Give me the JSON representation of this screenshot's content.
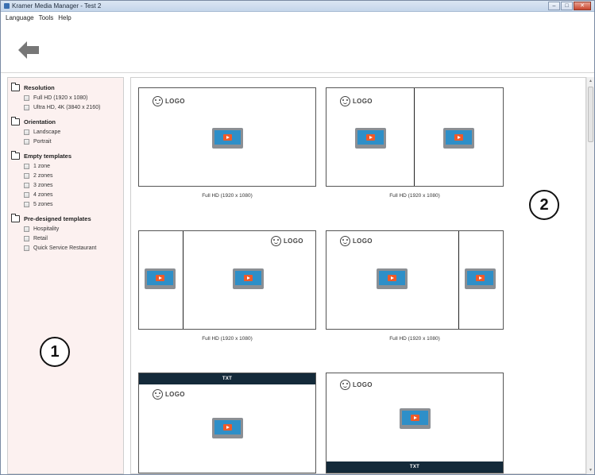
{
  "window": {
    "title": "Kramer Media Manager - Test 2",
    "controls": [
      "minimize",
      "maximize",
      "close"
    ]
  },
  "menu": [
    "Language",
    "Tools",
    "Help"
  ],
  "toolbar": {
    "back_icon": "back-arrow-icon"
  },
  "sidebar": {
    "groups": [
      {
        "label": "Resolution",
        "options": [
          "Full HD (1920 x 1080)",
          "Ultra HD, 4K (3840 x 2160)"
        ]
      },
      {
        "label": "Orientation",
        "options": [
          "Landscape",
          "Portrait"
        ]
      },
      {
        "label": "Empty templates",
        "options": [
          "1 zone",
          "2 zones",
          "3 zones",
          "4 zones",
          "5 zones"
        ]
      },
      {
        "label": "Pre-designed templates",
        "options": [
          "Hospitality",
          "Retail",
          "Quick Service Restaurant"
        ]
      }
    ]
  },
  "callouts": {
    "one": "1",
    "two": "2"
  },
  "templates": {
    "captions": [
      "Full HD (1920 x 1080)",
      "Full HD (1920 x 1080)",
      "Full HD (1920 x 1080)",
      "Full HD (1920 x 1080)"
    ],
    "logo_text": "LOGO",
    "txt_label": "TXT"
  },
  "colors": {
    "sidebar_bg": "#fcf1f0",
    "media_screen": "#2e8fc8",
    "play_button": "#f05a28",
    "txt_bar": "#142a3a"
  }
}
